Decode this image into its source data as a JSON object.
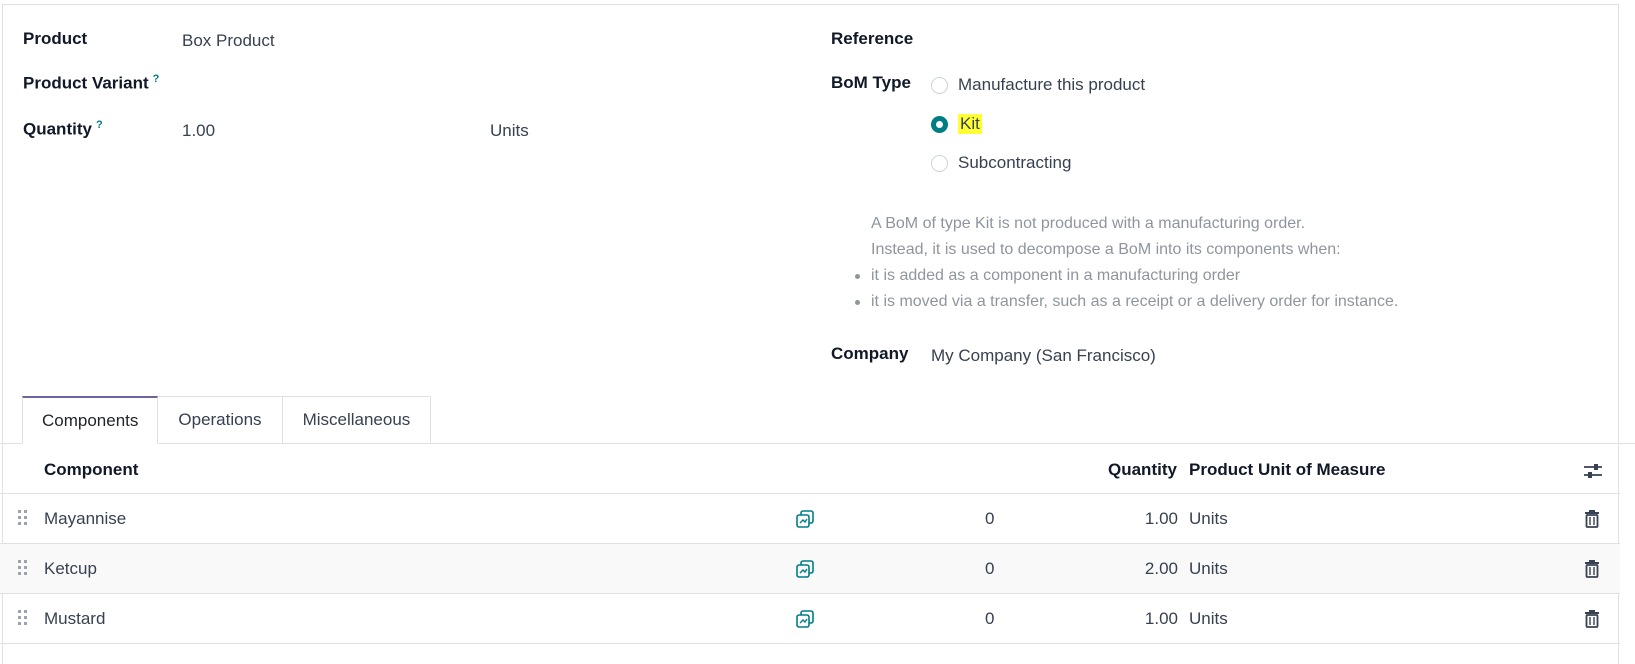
{
  "form": {
    "product_label": "Product",
    "product_value": "Box Product",
    "variant_label": "Product Variant",
    "variant_help": "?",
    "quantity_label": "Quantity",
    "quantity_help": "?",
    "quantity_value": "1.00",
    "quantity_uom": "Units",
    "reference_label": "Reference",
    "bom_type_label": "BoM Type",
    "bom_type_options": [
      "Manufacture this product",
      "Kit",
      "Subcontracting"
    ],
    "bom_type_selected": "Kit",
    "help_line_1": "A BoM of type Kit is not produced with a manufacturing order.",
    "help_line_2": "Instead, it is used to decompose a BoM into its components when:",
    "help_bullet_1": "it is added as a component in a manufacturing order",
    "help_bullet_2": "it is moved via a transfer, such as a receipt or a delivery order for instance.",
    "company_label": "Company",
    "company_value": "My Company (San Francisco)"
  },
  "tabs": [
    "Components",
    "Operations",
    "Miscellaneous"
  ],
  "table": {
    "headers": {
      "component": "Component",
      "quantity": "Quantity",
      "uom": "Product Unit of Measure"
    },
    "rows": [
      {
        "component": "Mayannise",
        "availability": "0",
        "quantity": "1.00",
        "uom": "Units"
      },
      {
        "component": "Ketcup",
        "availability": "0",
        "quantity": "2.00",
        "uom": "Units"
      },
      {
        "component": "Mustard",
        "availability": "0",
        "quantity": "1.00",
        "uom": "Units"
      }
    ]
  },
  "colors": {
    "accent": "#017e84",
    "tab_active": "#71639e",
    "highlight": "#ffff33"
  },
  "icons": {
    "row_handle": "drag-handle-icon",
    "forecast": "forecast-report-icon",
    "delete": "trash-icon",
    "optional_columns": "sliders-icon"
  }
}
